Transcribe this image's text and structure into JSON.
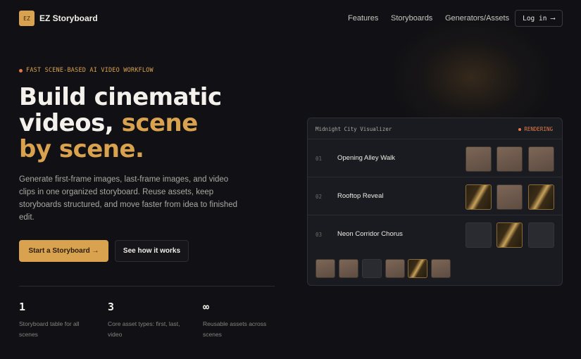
{
  "nav": {
    "logo_mark": "EZ",
    "brand": "EZ Storyboard",
    "links": [
      "Features",
      "Storyboards",
      "Generators/Assets"
    ],
    "login": "Log in ⟶"
  },
  "hero": {
    "eyebrow": "FAST SCENE-BASED AI VIDEO WORKFLOW",
    "headline_part1": "Build cinematic videos, ",
    "headline_accent": "scene by scene.",
    "description": "Generate first-frame images, last-frame images, and video clips in one organized storyboard. Reuse assets, keep storyboards structured, and move faster from idea to finished edit.",
    "cta_primary": "Start a Storyboard →",
    "cta_secondary": "See how it works"
  },
  "stats": [
    {
      "value": "1",
      "label": "Storyboard table for all scenes"
    },
    {
      "value": "3",
      "label": "Core asset types: first, last, video"
    },
    {
      "value": "∞",
      "label": "Reusable assets across scenes"
    }
  ],
  "panel": {
    "title": "Midnight City Visualizer",
    "status": "RENDERING",
    "rows": [
      {
        "num": "01",
        "name": "Opening Alley Walk",
        "thumbs": [
          "warm",
          "warm",
          "warm"
        ]
      },
      {
        "num": "02",
        "name": "Rooftop Reveal",
        "thumbs": [
          "gold",
          "warm",
          "gold"
        ]
      },
      {
        "num": "03",
        "name": "Neon Corridor Chorus",
        "thumbs": [
          "dark",
          "gold",
          "dark"
        ]
      }
    ],
    "assets": [
      "warm",
      "warm",
      "dark",
      "warm",
      "gold",
      "warm"
    ]
  },
  "colors": {
    "accent": "#d9a24e",
    "status": "#e07a4a",
    "background": "#111115"
  }
}
